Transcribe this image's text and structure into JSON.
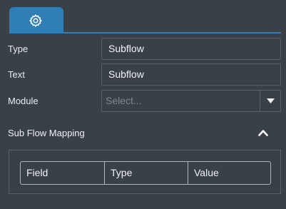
{
  "tabs": [
    {
      "icon": "gear-icon",
      "active": true
    }
  ],
  "colors": {
    "accent": "#2f7fb6",
    "background": "#3a4048",
    "border": "#59616b"
  },
  "fields": {
    "type": {
      "label": "Type",
      "value": "Subflow"
    },
    "text": {
      "label": "Text",
      "value": "Subflow"
    },
    "module": {
      "label": "Module",
      "placeholder": "Select..."
    }
  },
  "section": {
    "title": "Sub Flow Mapping",
    "collapse_icon": "chevron-up-icon"
  },
  "mapping_table": {
    "columns": [
      "Field",
      "Type",
      "Value"
    ]
  }
}
